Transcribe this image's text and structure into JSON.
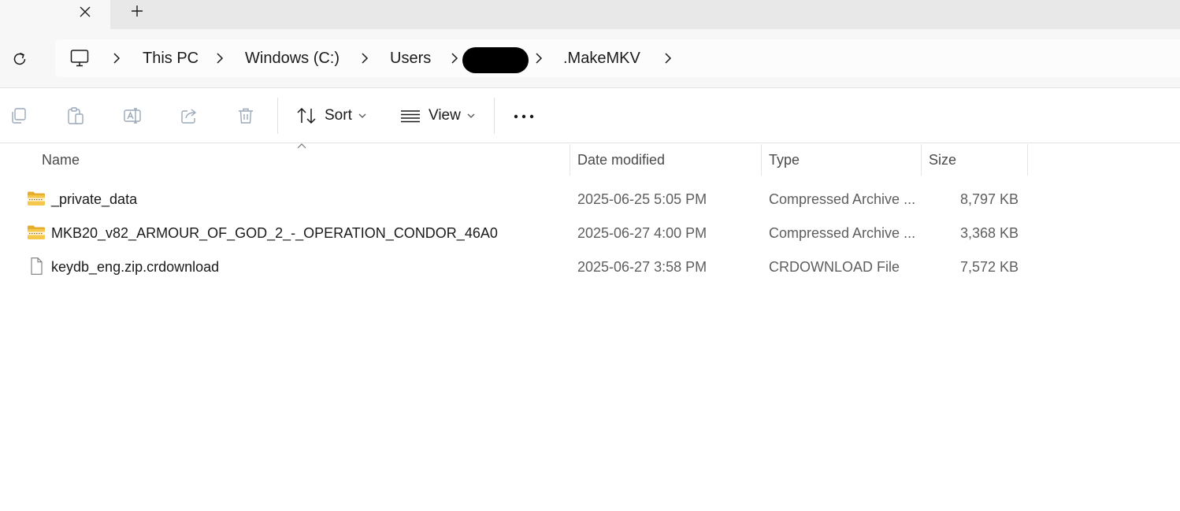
{
  "tabs": {
    "close_glyph": "✕",
    "new_tab_glyph": "+"
  },
  "address": {
    "crumbs": [
      {
        "label": "This PC"
      },
      {
        "label": "Windows (C:)"
      },
      {
        "label": "Users"
      },
      {
        "label": ""
      },
      {
        "label": ".MakeMKV"
      }
    ]
  },
  "commands": {
    "sort_label": "Sort",
    "view_label": "View",
    "icons": [
      "copy-icon",
      "paste-icon",
      "rename-icon",
      "share-icon",
      "delete-icon"
    ]
  },
  "columns": {
    "name": "Name",
    "date": "Date modified",
    "type": "Type",
    "size": "Size"
  },
  "files": [
    {
      "icon": "zip-folder-icon",
      "name": "_private_data",
      "date": "2025-06-25 5:05 PM",
      "type": "Compressed Archive ...",
      "size": "8,797 KB"
    },
    {
      "icon": "zip-folder-icon",
      "name": "MKB20_v82_ARMOUR_OF_GOD_2_-_OPERATION_CONDOR_46A0",
      "date": "2025-06-27 4:00 PM",
      "type": "Compressed Archive ...",
      "size": "3,368 KB"
    },
    {
      "icon": "file-icon",
      "name": "keydb_eng.zip.crdownload",
      "date": "2025-06-27 3:58 PM",
      "type": "CRDOWNLOAD File",
      "size": "7,572 KB"
    }
  ],
  "colors": {
    "accent": "#0067c0",
    "folder": "#f2c94c",
    "disabled_icon": "#9aa9b8"
  }
}
